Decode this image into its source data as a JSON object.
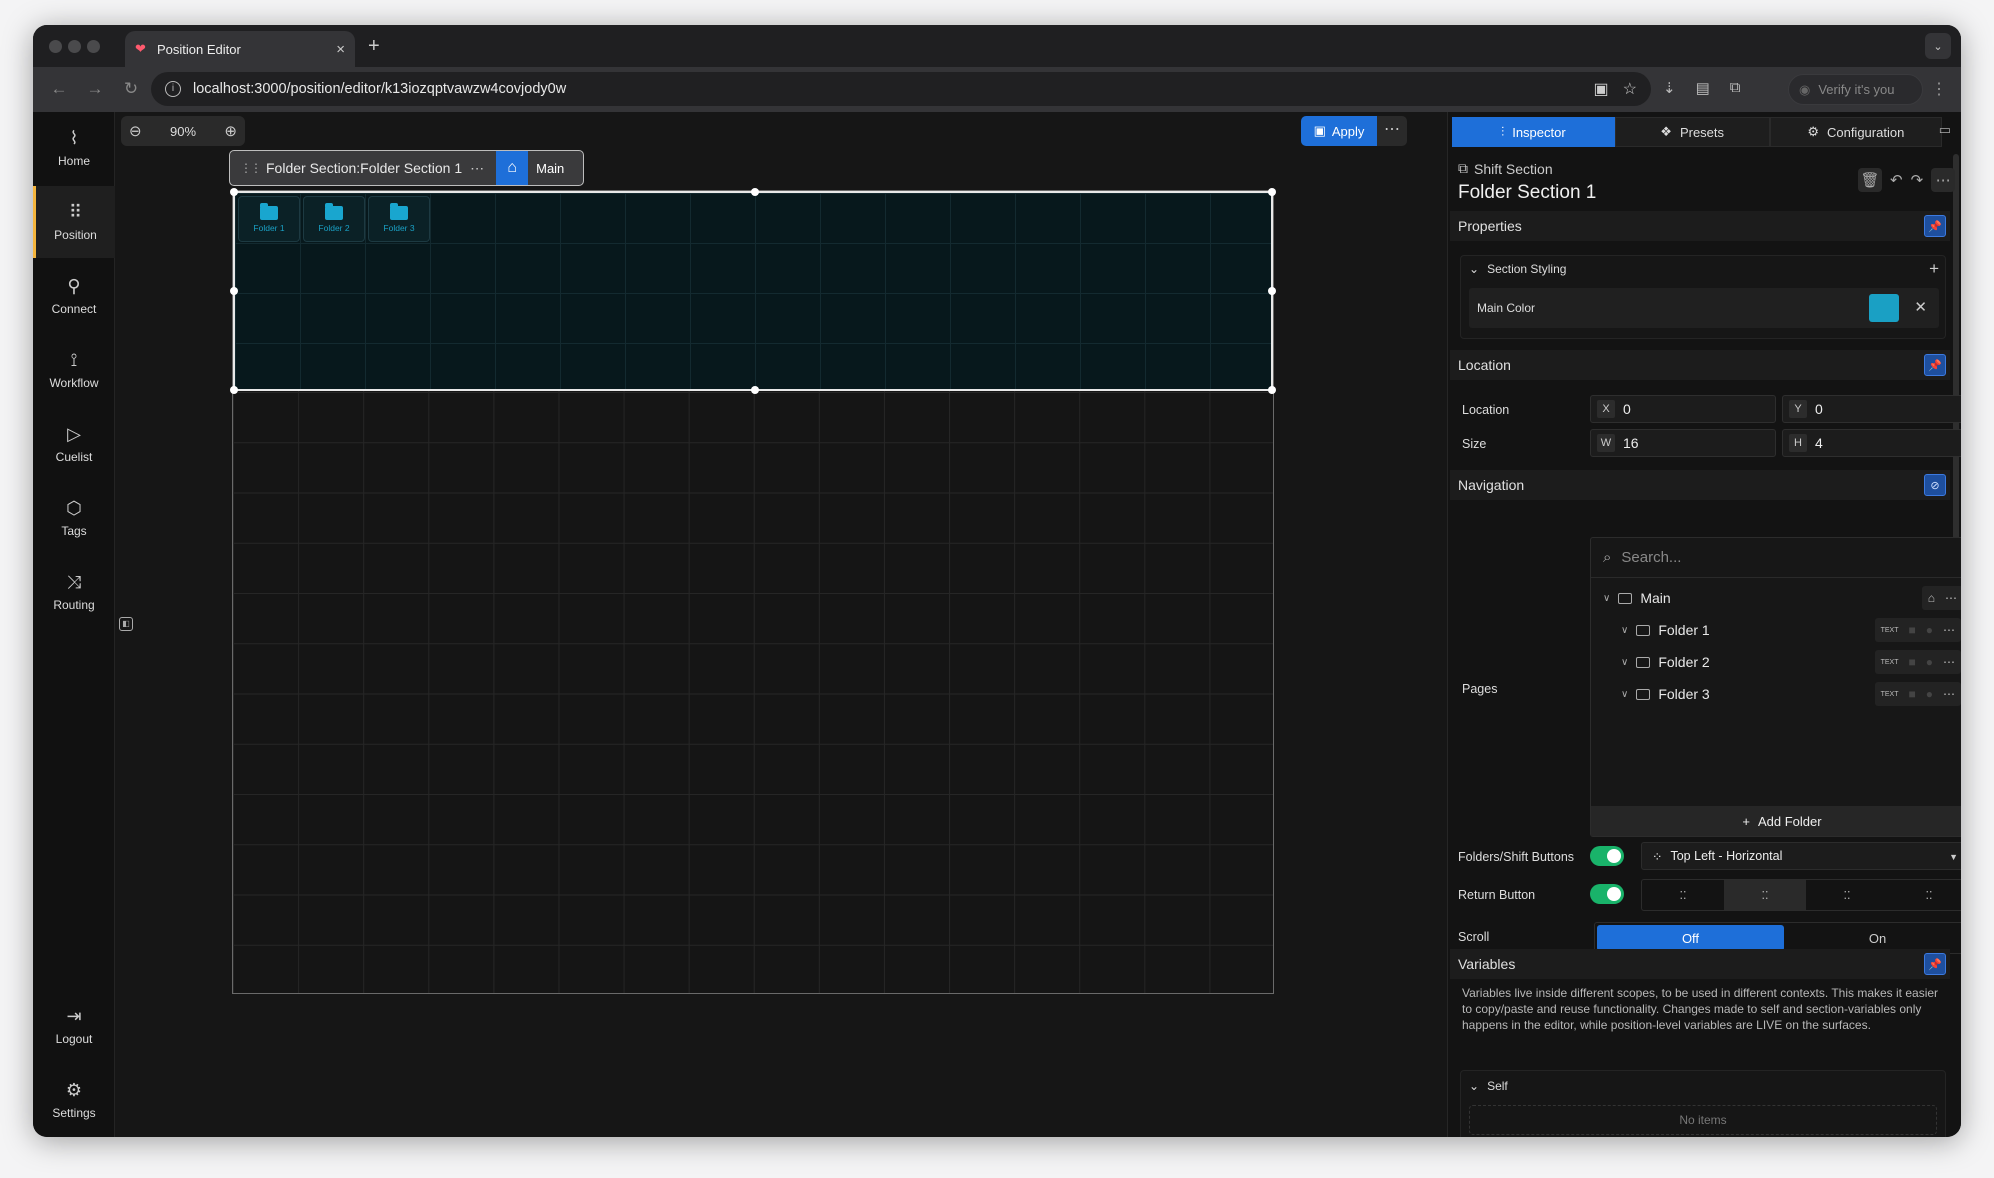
{
  "browser": {
    "tab_title": "Position Editor",
    "url": "localhost:3000/position/editor/k13iozqptvawzw4covjody0w",
    "verify_label": "Verify it's you"
  },
  "sidebar": {
    "items": [
      {
        "label": "Home",
        "icon": "activity-icon"
      },
      {
        "label": "Position",
        "icon": "grid-dots-icon"
      },
      {
        "label": "Connect",
        "icon": "plug-icon"
      },
      {
        "label": "Workflow",
        "icon": "workflow-icon"
      },
      {
        "label": "Cuelist",
        "icon": "play-icon"
      },
      {
        "label": "Tags",
        "icon": "tag-icon"
      },
      {
        "label": "Routing",
        "icon": "shuffle-icon"
      },
      {
        "label": "Logout",
        "icon": "logout-icon"
      },
      {
        "label": "Settings",
        "icon": "gear-icon"
      }
    ],
    "active": "Position",
    "accent": "#f5b53d"
  },
  "canvas": {
    "zoom": "90%",
    "apply_label": "Apply",
    "section_label": "Folder Section:Folder Section 1",
    "main_label": "Main",
    "folders": [
      "Folder 1",
      "Folder 2",
      "Folder 3"
    ],
    "section_color": "#1aa0c4"
  },
  "inspector": {
    "tabs": [
      "Inspector",
      "Presets",
      "Configuration"
    ],
    "type_label": "Shift Section",
    "title": "Folder Section 1",
    "properties": {
      "heading": "Properties",
      "styling_heading": "Section Styling",
      "main_color_label": "Main Color",
      "main_color": "#1aa0c4"
    },
    "location": {
      "heading": "Location",
      "location_label": "Location",
      "size_label": "Size",
      "x_key": "X",
      "x": "0",
      "y_key": "Y",
      "y": "0",
      "w_key": "W",
      "w": "16",
      "h_key": "H",
      "h": "4"
    },
    "navigation": {
      "heading": "Navigation",
      "pages_label": "Pages",
      "search_placeholder": "Search...",
      "root": "Main",
      "children": [
        "Folder 1",
        "Folder 2",
        "Folder 3"
      ],
      "text_badge": "TEXT",
      "add_folder": "Add Folder",
      "folders_shift_label": "Folders/Shift Buttons",
      "folders_shift_value": "Top Left - Horizontal",
      "return_button_label": "Return Button",
      "scroll_label": "Scroll",
      "scroll_off": "Off",
      "scroll_on": "On"
    },
    "variables": {
      "heading": "Variables",
      "description": "Variables live inside different scopes, to be used in different contexts. This makes it easier to copy/paste and reuse functionality. Changes made to self and section-variables only happens in the editor, while position-level variables are LIVE on the surfaces.",
      "self_label": "Self",
      "no_items": "No items"
    }
  }
}
